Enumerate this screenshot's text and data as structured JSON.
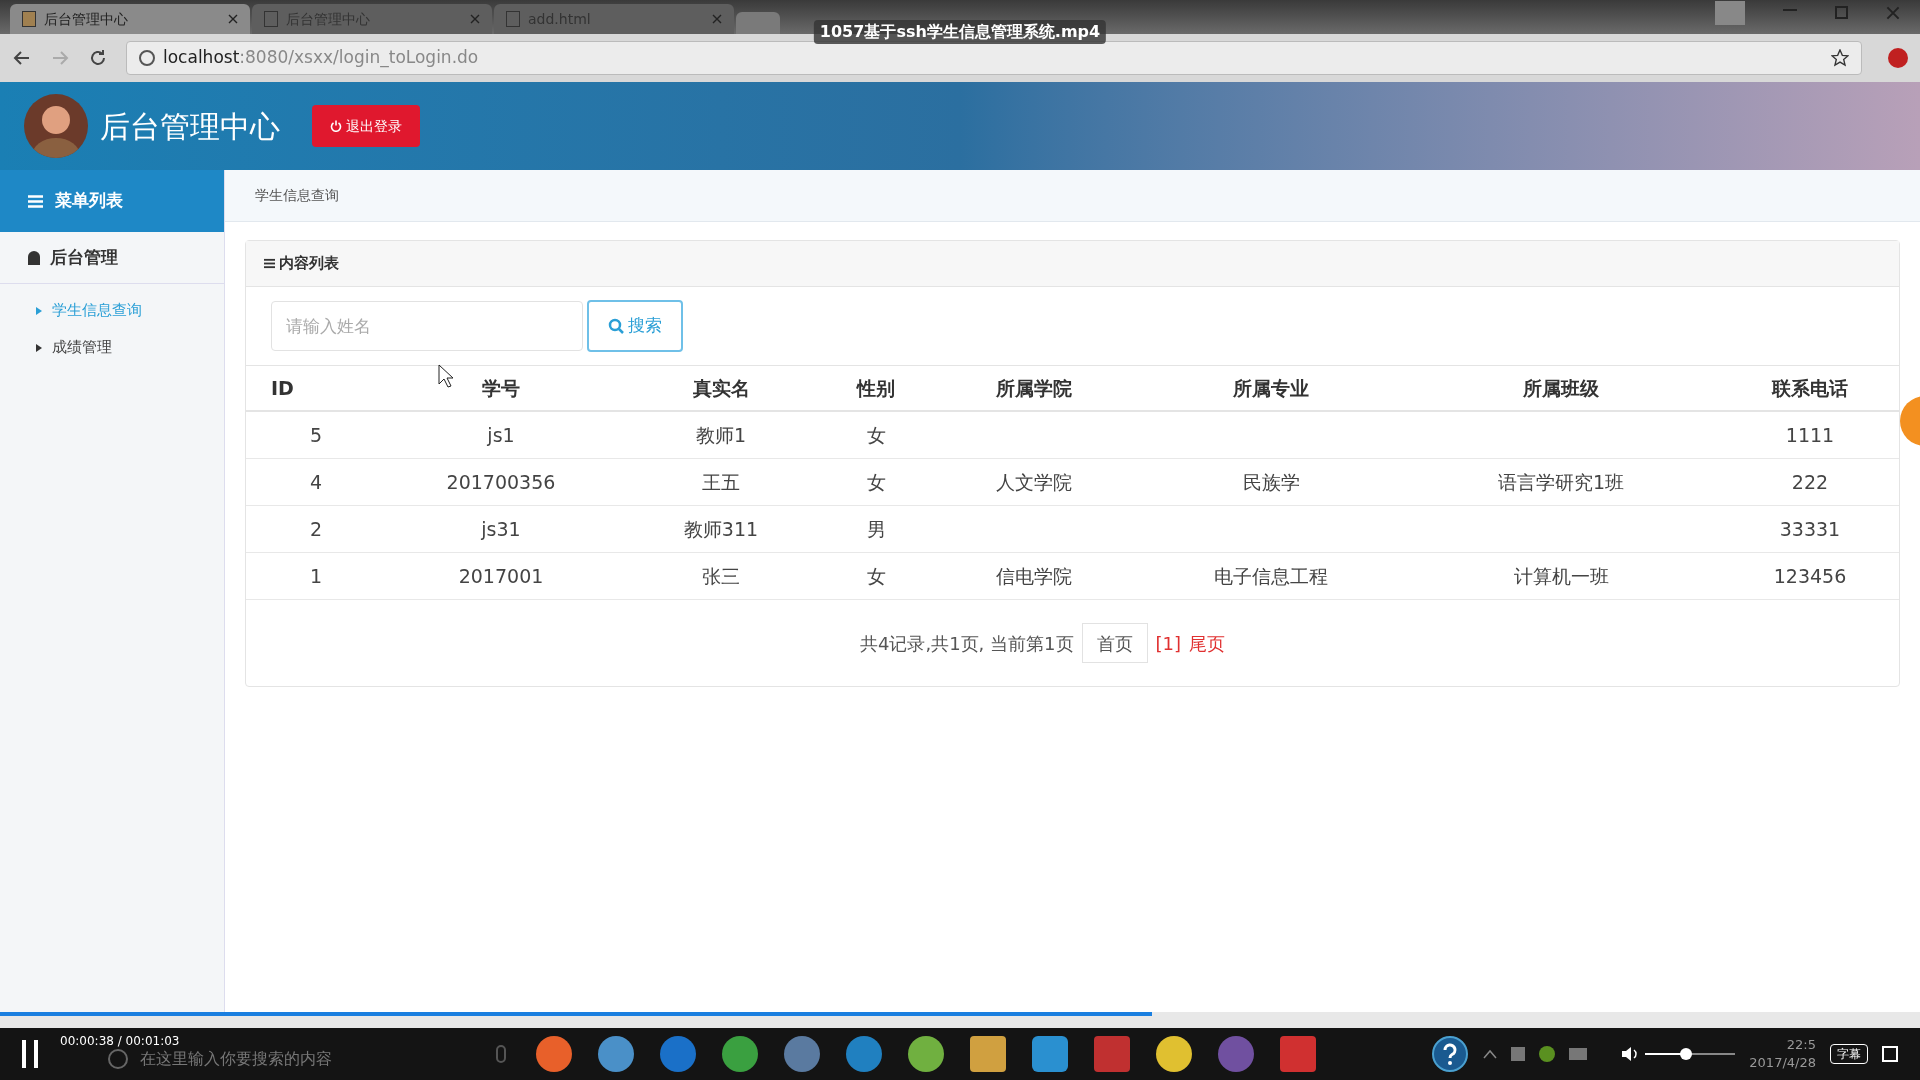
{
  "video": {
    "title": "1057基于ssh学生信息管理系统.mp4",
    "time": "00:00:38 / 00:01:03",
    "level": 0.6,
    "subtitle_button": "字幕"
  },
  "browser": {
    "tabs": [
      {
        "label": "后台管理中心",
        "selected": true
      },
      {
        "label": "后台管理中心",
        "selected": false
      },
      {
        "label": "add.html",
        "selected": false
      }
    ],
    "url_host": "localhost",
    "url_rest": ":8080/xsxx/login_toLogin.do"
  },
  "header": {
    "title": "后台管理中心",
    "logout": "退出登录"
  },
  "sidebar": {
    "title": "菜单列表",
    "section": "后台管理",
    "items": [
      {
        "label": "学生信息查询",
        "selected": true
      },
      {
        "label": "成绩管理",
        "selected": false
      }
    ]
  },
  "breadcrumb": "学生信息查询",
  "panel": {
    "title": "内容列表",
    "search": {
      "placeholder": "请输入姓名",
      "button": "搜索"
    }
  },
  "table": {
    "columns": [
      "ID",
      "学号",
      "真实名",
      "性别",
      "所属学院",
      "所属专业",
      "所属班级",
      "联系电话"
    ],
    "rows": [
      [
        "5",
        "js1",
        "教师1",
        "女",
        "",
        "",
        "",
        "1111"
      ],
      [
        "4",
        "201700356",
        "王五",
        "女",
        "人文学院",
        "民族学",
        "语言学研究1班",
        "222"
      ],
      [
        "2",
        "js31",
        "教师311",
        "男",
        "",
        "",
        "",
        "33331"
      ],
      [
        "1",
        "2017001",
        "张三",
        "女",
        "信电学院",
        "电子信息工程",
        "计算机一班",
        "123456"
      ]
    ]
  },
  "pager": {
    "summary": "共4记录,共1页, 当前第1页",
    "first": "首页",
    "current": "[1]",
    "last": "尾页"
  },
  "taskbar": {
    "search_placeholder": "在这里输入你要搜索的内容",
    "time": "22:5",
    "date": "2017/4/28",
    "volume": {
      "level": 0.45
    }
  }
}
